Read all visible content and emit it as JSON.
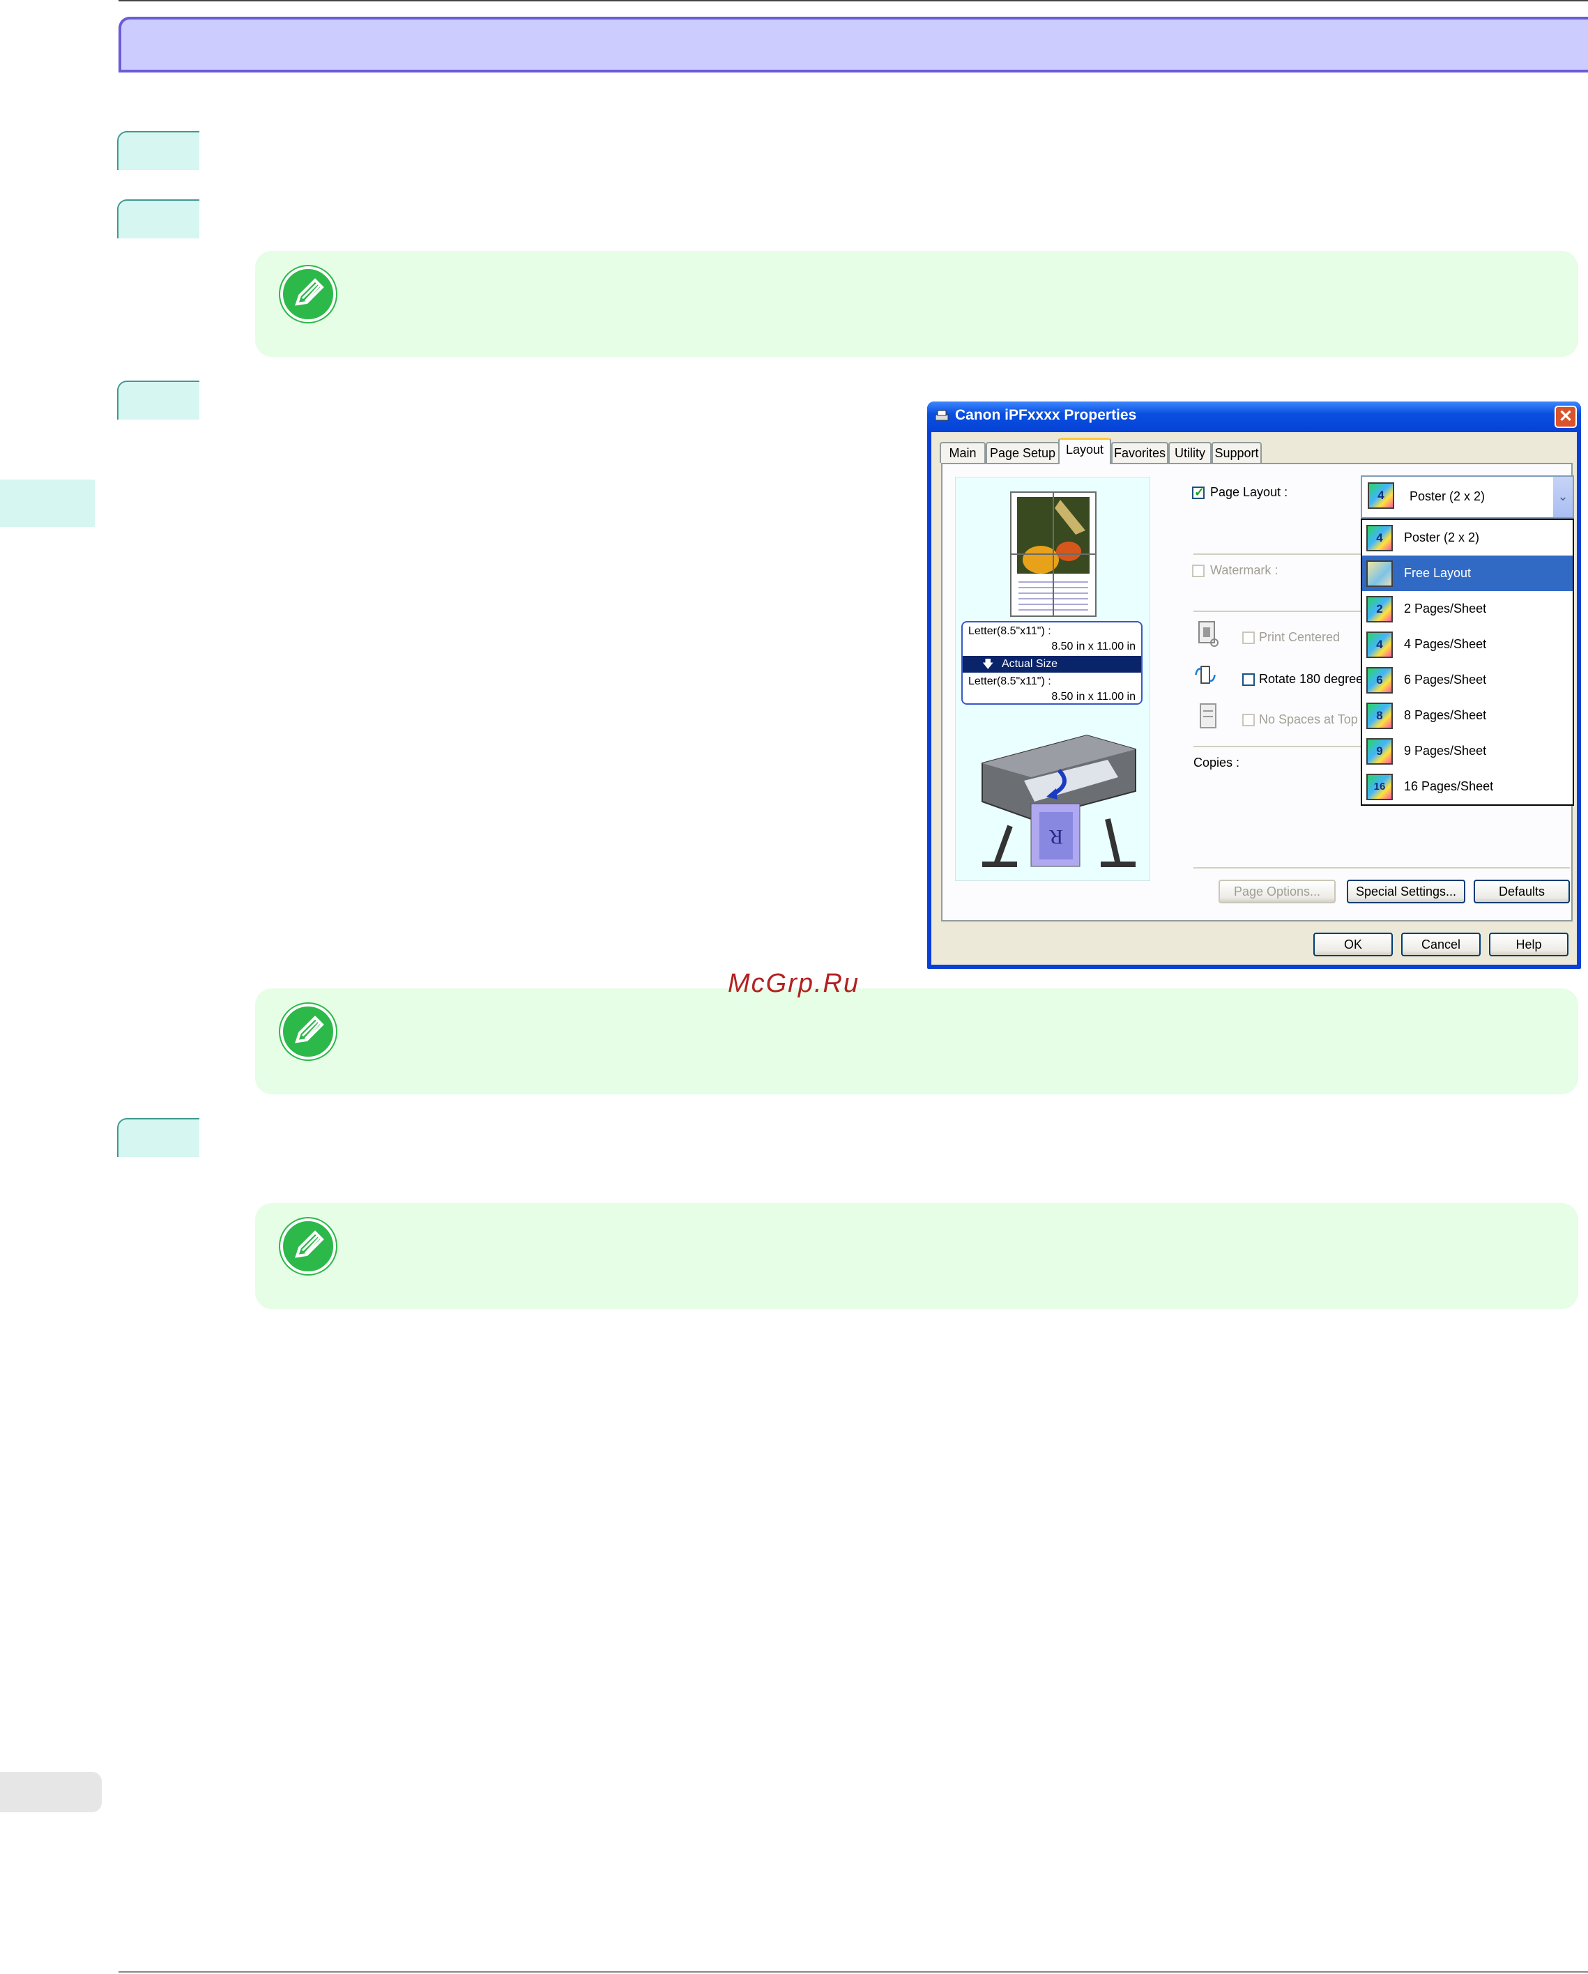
{
  "dialog": {
    "title": "Canon iPFxxxx Properties",
    "close_glyph": "✕",
    "tabs": [
      "Main",
      "Page Setup",
      "Layout",
      "Favorites",
      "Utility",
      "Support"
    ],
    "active_tab": "Layout",
    "preview": {
      "size_line1": "Letter(8.5\"x11\") :",
      "size_line2": "8.50 in x 11.00 in",
      "actual_size": "Actual Size",
      "arrow_glyph": "🡇",
      "size_line3": "Letter(8.5\"x11\") :",
      "size_line4": "8.50 in x 11.00 in"
    },
    "page_layout": {
      "label": "Page Layout :",
      "checked": true,
      "selected": "Poster (2 x 2)",
      "options": [
        {
          "label": "Poster (2 x 2)",
          "badge": "4"
        },
        {
          "label": "Free Layout",
          "badge": "",
          "selected": true
        },
        {
          "label": "2 Pages/Sheet",
          "badge": "2"
        },
        {
          "label": "4 Pages/Sheet",
          "badge": "4"
        },
        {
          "label": "6 Pages/Sheet",
          "badge": "6"
        },
        {
          "label": "8 Pages/Sheet",
          "badge": "8"
        },
        {
          "label": "9 Pages/Sheet",
          "badge": "9"
        },
        {
          "label": "16 Pages/Sheet",
          "badge": "16"
        }
      ]
    },
    "watermark_label": "Watermark :",
    "print_centered_label": "Print Centered",
    "rotate_label": "Rotate 180 degree",
    "no_spaces_label": "No Spaces at Top",
    "copies_label": "Copies :",
    "buttons": {
      "page_options": "Page Options...",
      "special_settings": "Special Settings...",
      "defaults": "Defaults",
      "ok": "OK",
      "cancel": "Cancel",
      "help": "Help"
    }
  },
  "watermark_site": "McGrp.Ru",
  "colors": {
    "title_band": "#ccccff",
    "step_tab": "#d6f6f2",
    "note_bg": "#e6fde6",
    "note_icon": "#2db84a",
    "xp_blue": "#0a50e0",
    "selection": "#316ac5"
  }
}
